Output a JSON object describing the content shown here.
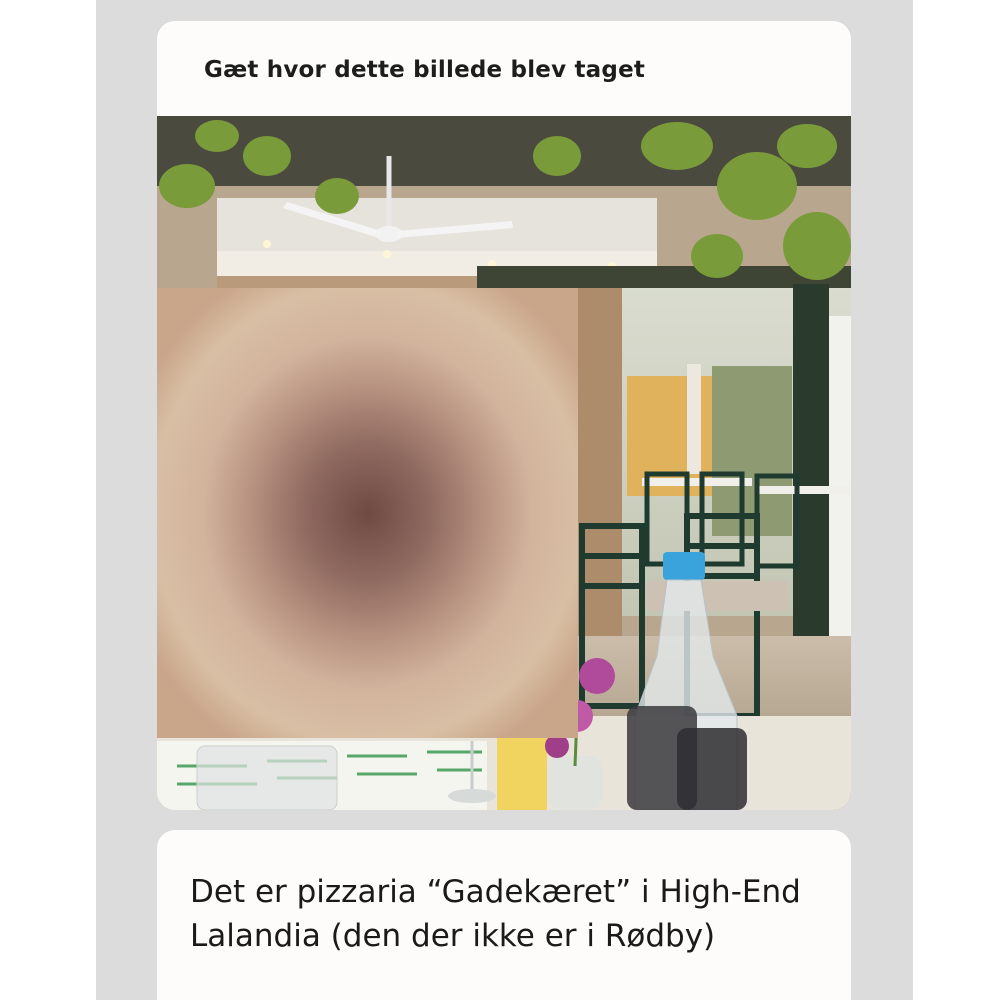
{
  "prompt": {
    "title": "Gæt hvor dette billede blev taget"
  },
  "photo": {
    "icon": "restaurant-photo",
    "blurred_region": "blurred-face"
  },
  "answer": {
    "text": "Det er pizzaria “Gadekæret” i High-End Lalandia (den der ikke er i Rødby)"
  }
}
